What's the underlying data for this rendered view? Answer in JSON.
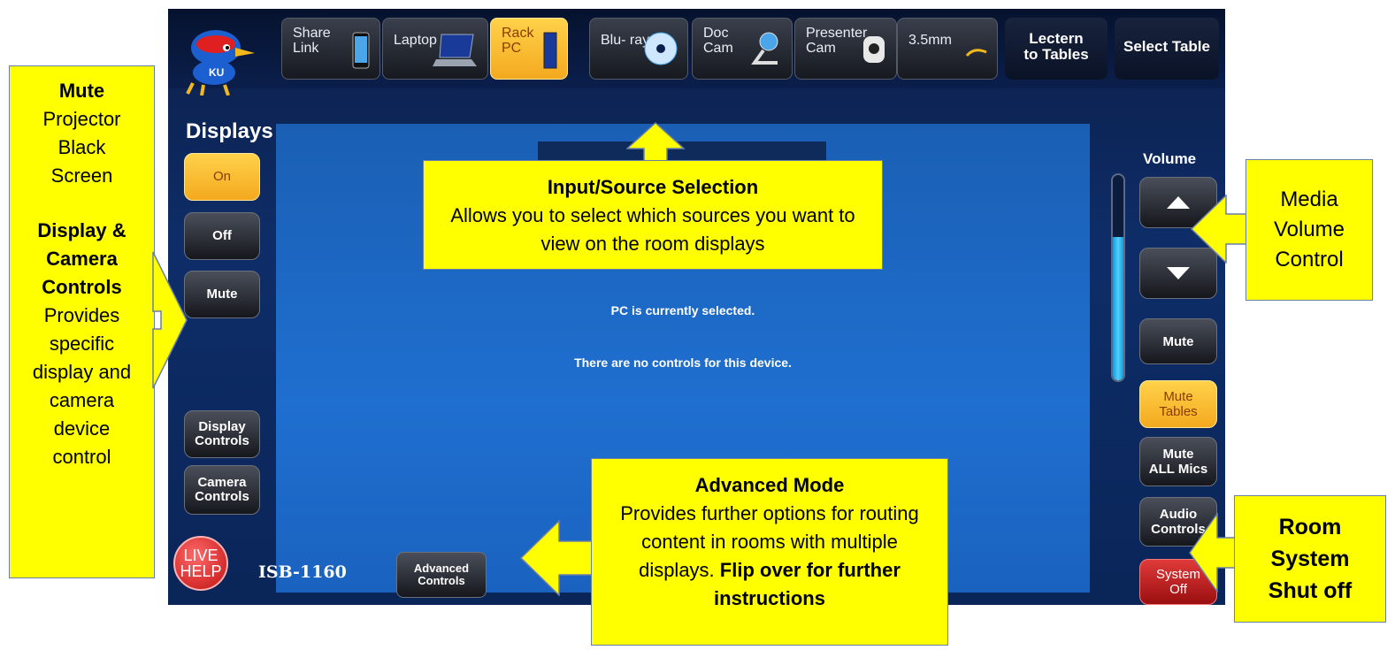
{
  "panel": {
    "sources": [
      {
        "label": "Share\nLink",
        "icon": "phone-icon",
        "active": false
      },
      {
        "label": "Laptop",
        "icon": "laptop-icon",
        "active": false
      },
      {
        "label": "Rack\nPC",
        "icon": "pc-tower-icon",
        "active": true
      },
      {
        "label": "Blu- ray",
        "icon": "disc-icon",
        "active": false
      },
      {
        "label": "Doc\nCam",
        "icon": "webcam-icon",
        "active": false
      },
      {
        "label": "Presenter\nCam",
        "icon": "ptz-camera-icon",
        "active": false
      },
      {
        "label": "3.5mm",
        "icon": "audio-cable-icon",
        "active": false
      }
    ],
    "lectern_to_tables": "Lectern\nto Tables",
    "select_table": "Select Table",
    "displays_title": "Displays",
    "display_buttons": {
      "on": "On",
      "off": "Off",
      "mute": "Mute"
    },
    "display_controls": "Display\nControls",
    "camera_controls": "Camera\nControls",
    "content": {
      "selected_text": "PC is currently selected.",
      "no_controls_text": "There are no controls for this device."
    },
    "volume": {
      "title": "Volume",
      "up_icon": "triangle-up-icon",
      "down_icon": "triangle-down-icon",
      "mute": "Mute",
      "level": 0.7
    },
    "mute_tables": "Mute\nTables",
    "mute_all_mics": "Mute\nALL Mics",
    "audio_controls": "Audio\nControls",
    "system_off": "System\nOff",
    "live_help": "LIVE\nHELP",
    "room_name": "ISB-1160",
    "advanced_controls": "Advanced\nControls"
  },
  "callouts": {
    "left": {
      "mute_title": "Mute",
      "mute_desc": "Projector Black Screen",
      "dc_title": "Display & Camera Controls",
      "dc_desc": "Provides specific display and camera device control"
    },
    "input": {
      "title": "Input/Source Selection",
      "desc": "Allows you to select which sources you want to view on the room displays"
    },
    "media": {
      "text": "Media\nVolume\nControl"
    },
    "advanced": {
      "title": "Advanced Mode",
      "desc": "Provides further options for routing content in rooms with multiple displays.",
      "bold_note": "Flip over for further instructions"
    },
    "room": {
      "text": "Room\nSystem\nShut off"
    }
  },
  "colors": {
    "callout": "#ffff00",
    "active_gold": "#f4a91f",
    "system_off_red": "#c21010"
  }
}
